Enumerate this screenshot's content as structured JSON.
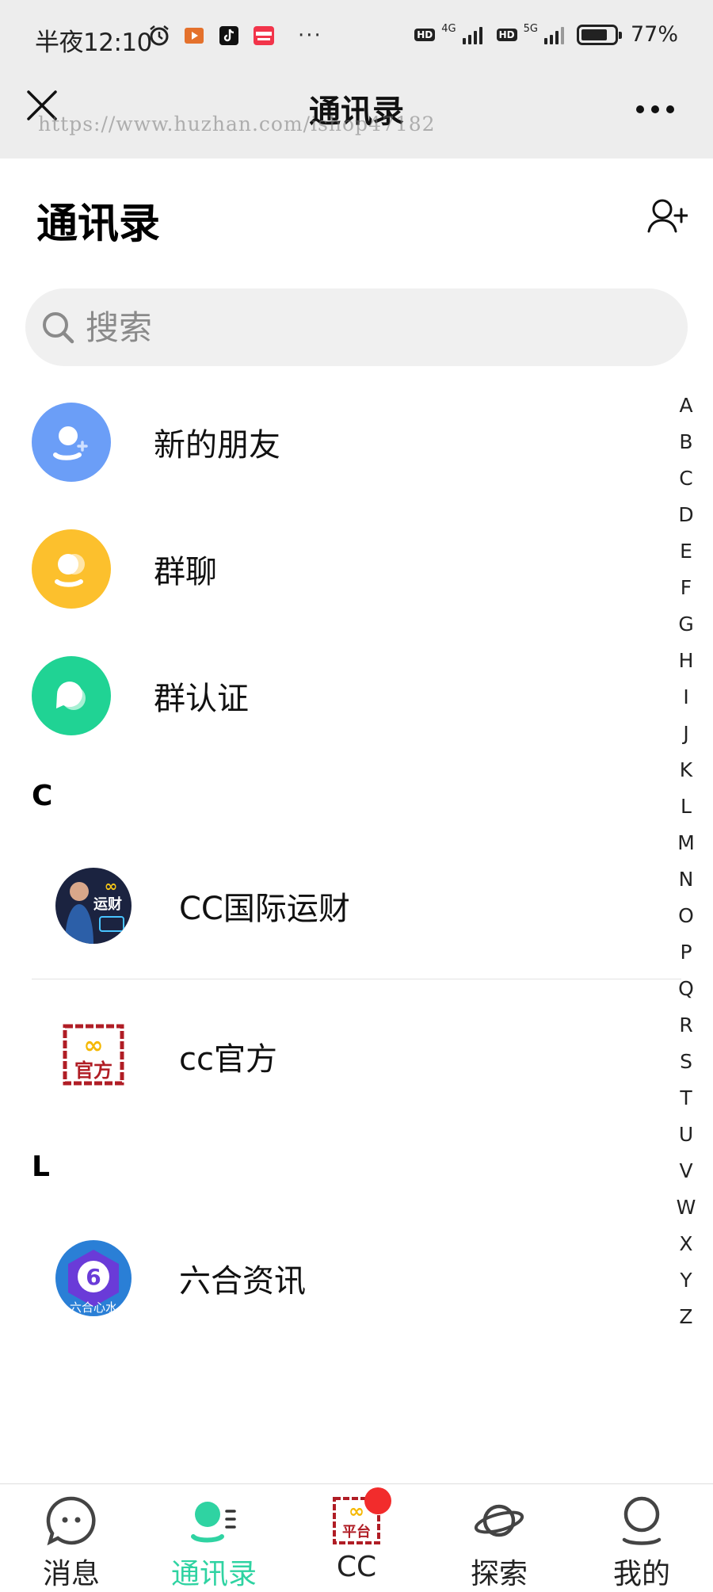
{
  "status_bar": {
    "time": "半夜12:10",
    "battery": "77%",
    "network_1": "4G",
    "network_2": "5G",
    "hd_label": "HD",
    "icons": [
      "alarm-icon",
      "video-app-icon",
      "tiktok-icon",
      "shopping-app-icon",
      "more-dots"
    ],
    "more_dots": "···"
  },
  "browser_header": {
    "title": "通讯录",
    "close_icon": "close-icon",
    "more_icon": "more-icon",
    "watermark": "https://www.huzhan.com/ishop47182"
  },
  "page": {
    "title": "通讯录",
    "add_contact_icon": "add-contact-icon"
  },
  "search": {
    "placeholder": "搜索",
    "value": ""
  },
  "functions": [
    {
      "label": "新的朋友",
      "icon": "new-friend-icon",
      "color": "#6b9ef7"
    },
    {
      "label": "群聊",
      "icon": "group-chat-icon",
      "color": "#fcc02d"
    },
    {
      "label": "群认证",
      "icon": "group-verify-icon",
      "color": "#20d394"
    }
  ],
  "sections": [
    {
      "letter": "C",
      "contacts": [
        {
          "name": "CC国际运财",
          "avatar": "cc-international-avatar",
          "avatar_text": "运财"
        },
        {
          "name": "cc官方",
          "avatar": "cc-official-avatar",
          "avatar_text": "官方"
        }
      ]
    },
    {
      "letter": "L",
      "contacts": [
        {
          "name": "六合资讯",
          "avatar": "liuhe-news-avatar",
          "avatar_text": "六合心水"
        }
      ]
    }
  ],
  "index_letters": [
    "A",
    "B",
    "C",
    "D",
    "E",
    "F",
    "G",
    "H",
    "I",
    "J",
    "K",
    "L",
    "M",
    "N",
    "O",
    "P",
    "Q",
    "R",
    "S",
    "T",
    "U",
    "V",
    "W",
    "X",
    "Y",
    "Z"
  ],
  "tabs": [
    {
      "label": "消息",
      "icon": "message-icon",
      "active": false
    },
    {
      "label": "通讯录",
      "icon": "contacts-icon",
      "active": true
    },
    {
      "label": "CC",
      "icon": "cc-platform-icon",
      "active": false,
      "badge": true,
      "icon_text": "平台"
    },
    {
      "label": "探索",
      "icon": "planet-icon",
      "active": false
    },
    {
      "label": "我的",
      "icon": "profile-icon",
      "active": false
    }
  ],
  "colors": {
    "accent": "#2fd3a2",
    "badge": "#f22c2c",
    "header_bg": "#ededed"
  }
}
